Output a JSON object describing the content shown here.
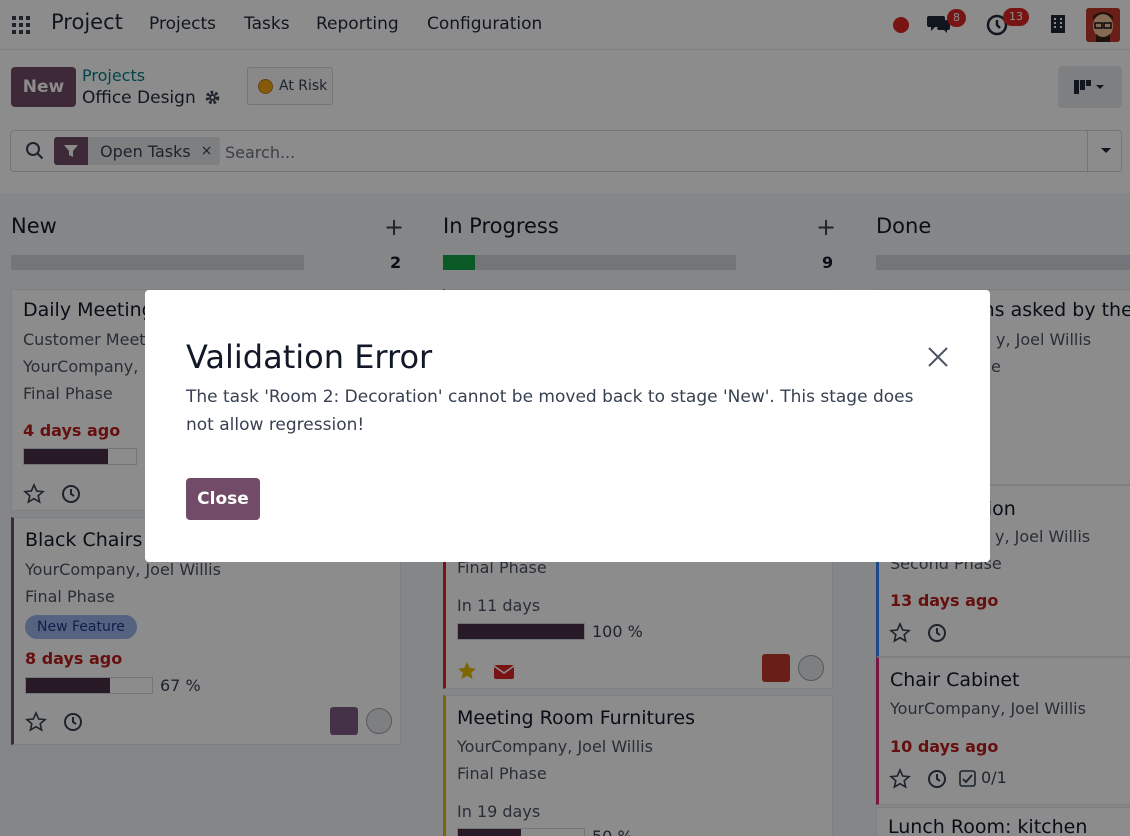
{
  "nav": {
    "app_name": "Project",
    "menu": [
      "Projects",
      "Tasks",
      "Reporting",
      "Configuration"
    ],
    "chat_badge": "8",
    "activity_badge": "13"
  },
  "control": {
    "new_label": "New",
    "breadcrumb_parent": "Projects",
    "breadcrumb_current": "Office Design",
    "status_label": "At Risk"
  },
  "search": {
    "facet_label": "Open Tasks",
    "facet_remove": "×",
    "placeholder": "Search..."
  },
  "columns": [
    {
      "title": "New",
      "count": "2"
    },
    {
      "title": "In Progress",
      "count": "9"
    },
    {
      "title": "Done",
      "count": ""
    }
  ],
  "cards": {
    "new_1": {
      "title": "Daily Meeting",
      "line1": "Customer Meet",
      "line2": "YourCompany, ",
      "line3": "Final Phase",
      "date": "4 days ago"
    },
    "new_2": {
      "title": "Black Chairs f",
      "line1": "YourCompany, Joel Willis",
      "line2": "Final Phase",
      "tag": "New Feature",
      "date": "8 days ago",
      "progress_text": "67 %"
    },
    "prog_1": {
      "line2": "Final Phase",
      "date": "In 11 days",
      "progress_text": "100 %"
    },
    "prog_2": {
      "title": "Meeting Room Furnitures",
      "line1": "YourCompany, Joel Willis",
      "line2": "Final Phase",
      "date": "In 19 days",
      "progress_text": "50 %"
    },
    "done_1": {
      "title": "ons asked by the",
      "line1": "y, Joel Willis",
      "line2": "e"
    },
    "done_2": {
      "title": "ction",
      "line1": "y, Joel Willis",
      "line2": "Second Phase",
      "date": "13 days ago"
    },
    "done_3": {
      "title": "Chair Cabinet",
      "line1": "YourCompany, Joel Willis",
      "date": "10 days ago",
      "checklist": "0/1"
    },
    "done_4": {
      "title": "Lunch Room: kitchen"
    }
  },
  "progress_values": {
    "new_1": 0.75,
    "new_2": 0.67,
    "prog_1": 1.0,
    "prog_2": 0.5
  },
  "column_fill": {
    "new": 0,
    "in_progress": 0.11,
    "done": 0
  },
  "modal": {
    "title": "Validation Error",
    "message": "The task 'Room 2: Decoration' cannot be moved back to stage 'New'. This stage does not allow regression!",
    "close_label": "Close"
  },
  "colors": {
    "brand": "#714b67",
    "danger": "#dc2626",
    "teal": "#017e84"
  }
}
